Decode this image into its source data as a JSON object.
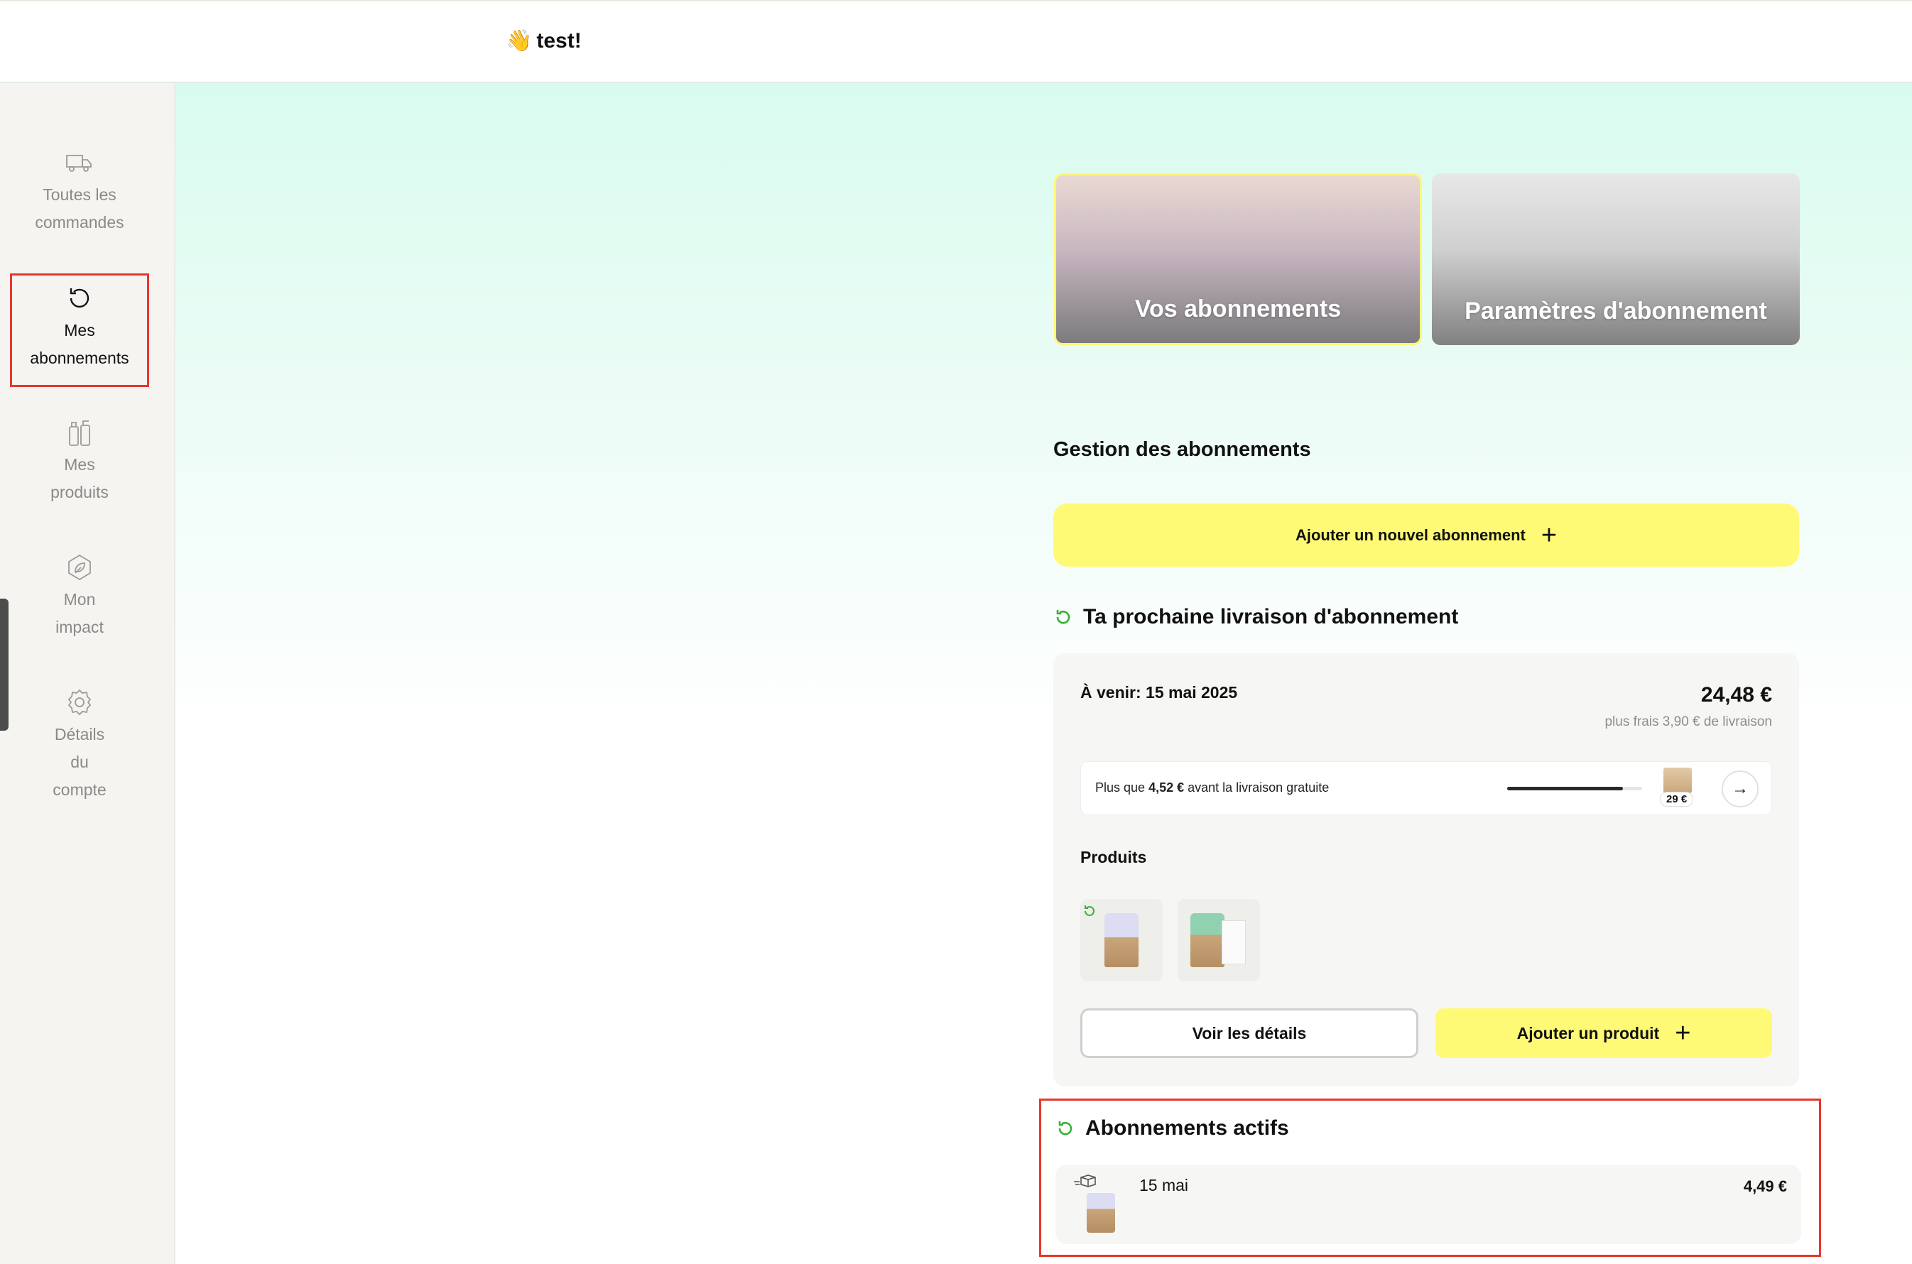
{
  "header": {
    "greeting_emoji": "👋",
    "greeting_text": "test!"
  },
  "sidebar": {
    "items": [
      {
        "line1": "Toutes les",
        "line2": "commandes",
        "icon": "truck-icon",
        "active": false
      },
      {
        "line1": "Mes",
        "line2": "abonnements",
        "icon": "refresh-icon",
        "active": true
      },
      {
        "line1": "Mes",
        "line2": "produits",
        "icon": "bottles-icon",
        "active": false
      },
      {
        "line1": "Mon",
        "line2": "impact",
        "icon": "leaf-icon",
        "active": false
      },
      {
        "line1": "Détails",
        "line2": "du",
        "line3": "compte",
        "icon": "gear-icon",
        "active": false
      }
    ]
  },
  "cards": {
    "subscriptions": "Vos abonnements",
    "settings": "Paramètres d'abonnement"
  },
  "management": {
    "title": "Gestion des abonnements",
    "add_button": "Ajouter un nouvel abonnement"
  },
  "next_delivery": {
    "title": "Ta prochaine livraison d'abonnement",
    "upcoming": "À venir: 15 mai 2025",
    "price": "24,48 €",
    "fees": "plus frais 3,90 € de livraison",
    "free_shipping_prefix": "Plus que ",
    "free_shipping_amount": "4,52 €",
    "free_shipping_suffix": " avant la livraison gratuite",
    "progress": 0.86,
    "threshold_badge": "29 €",
    "products_label": "Produits",
    "details_button": "Voir les détails",
    "add_product_button": "Ajouter un produit"
  },
  "active": {
    "title": "Abonnements actifs",
    "items": [
      {
        "date": "15 mai",
        "price": "4,49 €"
      }
    ]
  },
  "colors": {
    "accent_yellow": "#fffa75",
    "highlight_red": "#e6372d",
    "green": "#34b233"
  }
}
